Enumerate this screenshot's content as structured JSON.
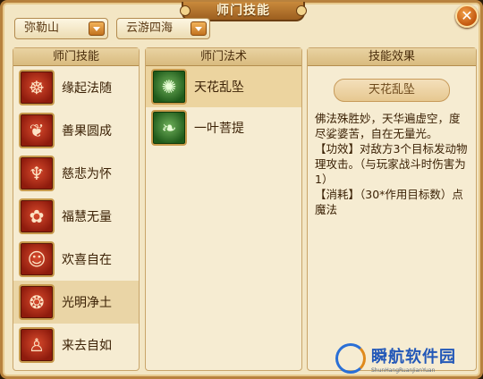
{
  "window": {
    "title": "师门技能"
  },
  "filters": {
    "school": "弥勒山",
    "mode": "云游四海"
  },
  "skills_panel": {
    "header": "师门技能",
    "items": [
      {
        "label": "缘起法随",
        "icon": "meditating-figure-icon",
        "selected": false
      },
      {
        "label": "善果圆成",
        "icon": "fruit-bowl-icon",
        "selected": false
      },
      {
        "label": "慈悲为怀",
        "icon": "praying-hands-icon",
        "selected": false
      },
      {
        "label": "福慧无量",
        "icon": "lotus-flower-icon",
        "selected": false
      },
      {
        "label": "欢喜自在",
        "icon": "laughing-buddha-icon",
        "selected": false
      },
      {
        "label": "光明净土",
        "icon": "flame-lotus-icon",
        "selected": true
      },
      {
        "label": "来去自如",
        "icon": "walking-monk-icon",
        "selected": false
      }
    ]
  },
  "spells_panel": {
    "header": "师门法术",
    "items": [
      {
        "label": "天花乱坠",
        "icon": "swirling-petals-icon",
        "selected": true
      },
      {
        "label": "一叶菩提",
        "icon": "bodhi-leaf-icon",
        "selected": false
      }
    ]
  },
  "effect_panel": {
    "header": "技能效果",
    "spell_name": "天花乱坠",
    "lines": [
      "佛法殊胜妙，天华遍虚空，度尽娑婆苦，自在无量光。",
      "【功效】对敌方3个目标发动物理攻击。（与玩家战斗时伤害为1）",
      "【消耗】（30*作用目标数）点魔法"
    ]
  },
  "watermark": {
    "cn": "瞬航软件园",
    "en": "ShunHangRuanJianYuan"
  },
  "colors": {
    "accent": "#c2721f",
    "frame": "#b8823e",
    "selected_row": "#ead5a6"
  }
}
